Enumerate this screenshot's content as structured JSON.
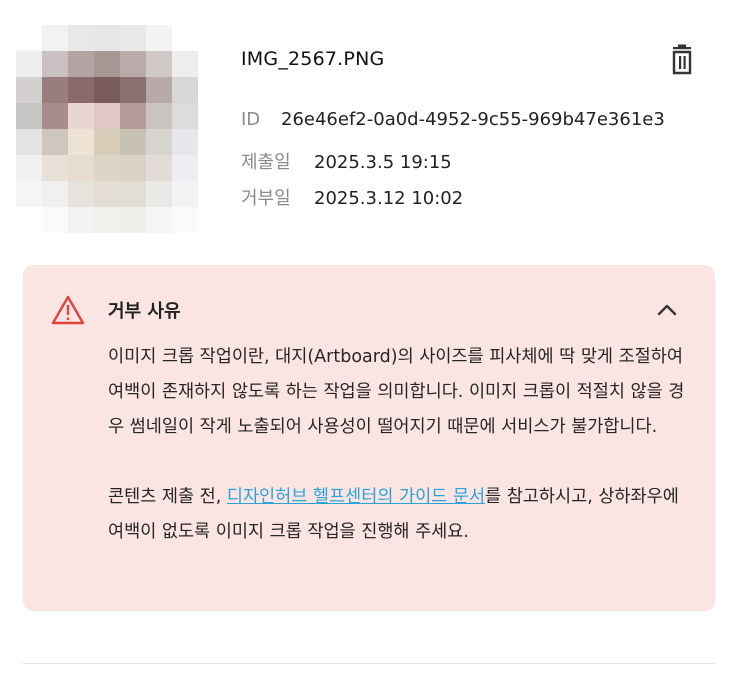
{
  "file": {
    "name": "IMG_2567.PNG",
    "id_label": "ID",
    "id_value": "26e46ef2-0a0d-4952-9c55-969b47e361e3",
    "submitted_label": "제출일",
    "submitted_value": "2025.3.5 19:15",
    "rejected_label": "거부일",
    "rejected_value": "2025.3.12 10:02"
  },
  "thumbnail": {
    "pixels": [
      "#ffffff",
      "#f2f2f2",
      "#e8e8e8",
      "#e6e6e6",
      "#e9e9e9",
      "#f3f3f3",
      "#ffffff",
      "#ffffff",
      "#eeeeee",
      "#c9c1c1",
      "#b4a3a2",
      "#a79896",
      "#b8abaa",
      "#cfc8c7",
      "#ededed",
      "#ffffff",
      "#d4d0d0",
      "#9a7d7f",
      "#8b6a6c",
      "#7a5b5b",
      "#8b7070",
      "#b8aaa9",
      "#d7d7d7",
      "#ffffff",
      "#c8c5c5",
      "#a98d8d",
      "#e8d6d4",
      "#e2c8c7",
      "#b39b9b",
      "#c9c3c2",
      "#dcdcdc",
      "#ffffff",
      "#e5e4e4",
      "#cfc6be",
      "#eee3d4",
      "#d7cdb8",
      "#c8c2b2",
      "#d7d3cd",
      "#e6e7ea",
      "#ffffff",
      "#f0f0f1",
      "#e8e1d8",
      "#e6ddd0",
      "#ddd6c8",
      "#d9d3c6",
      "#e1ddd6",
      "#eceef2",
      "#ffffff",
      "#f5f5f6",
      "#f1f0ee",
      "#e6e2dc",
      "#e3ddd4",
      "#e2ddd5",
      "#ebe9e6",
      "#f2f3f5",
      "#ffffff",
      "#ffffff",
      "#fafafa",
      "#f4f3f1",
      "#f2f0ed",
      "#f1efec",
      "#f6f5f4",
      "#fafafa",
      "#ffffff"
    ]
  },
  "icons": {
    "delete": "trash-icon",
    "warning": "warning-triangle-icon",
    "collapse": "chevron-up-icon"
  },
  "reason": {
    "title": "거부 사유",
    "para1": "이미지 크롭 작업이란, 대지(Artboard)의 사이즈를 피사체에 딱 맞게 조절하여 여백이 존재하지 않도록 하는 작업을 의미합니다. 이미지 크롭이 적절치 않을 경우 썸네일이 작게 노출되어 사용성이 떨어지기 때문에 서비스가 불가합니다.",
    "para2_prefix": "콘텐츠 제출 전, ",
    "link_text": "디자인허브 헬프센터의 가이드 문서",
    "para2_suffix": "를 참고하시고, 상하좌우에 여백이 없도록 이미지 크롭 작업을 진행해 주세요."
  },
  "colors": {
    "panel_bg": "#fbe5e3",
    "warning": "#e0443a",
    "link": "#2aa4d8"
  }
}
